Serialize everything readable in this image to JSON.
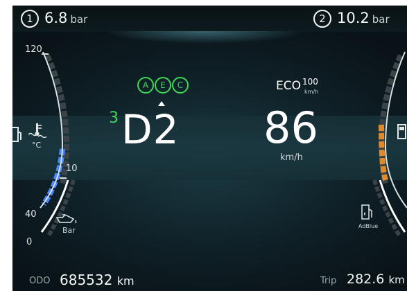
{
  "tire_pressure": {
    "left": {
      "position": "1",
      "value": "6.8",
      "unit": "bar"
    },
    "right": {
      "position": "2",
      "value": "10.2",
      "unit": "bar"
    }
  },
  "left_gauge": {
    "scale_top": "120",
    "coolant_unit": "°C",
    "coolant_low": "10",
    "oil_high": "40",
    "oil_low": "0",
    "oil_unit": "Bar",
    "coolant_icon": "coolant-temperature-icon",
    "oil_icon": "oil-pressure-icon",
    "coolant_fill_color": "#4a86ff"
  },
  "center": {
    "assist_indicators": [
      "A",
      "E",
      "C"
    ],
    "gear_prefix": "3",
    "gear": "D2",
    "speed": "86",
    "speed_unit": "km/h",
    "eco_label": "ECO",
    "eco_limit": "100",
    "eco_unit": "km/h",
    "indicator_color": "#3ed957"
  },
  "right_gauge": {
    "adblue_label": "AdBlue",
    "fuel_icon": "fuel-pump-icon",
    "adblue_icon": "adblue-pump-icon",
    "fuel_fill_color": "#e08a2c"
  },
  "bottom": {
    "odo_label": "ODO",
    "odo_value": "685532",
    "odo_unit": "km",
    "trip_label": "Trip",
    "trip_value": "282.6",
    "trip_unit": "km"
  }
}
